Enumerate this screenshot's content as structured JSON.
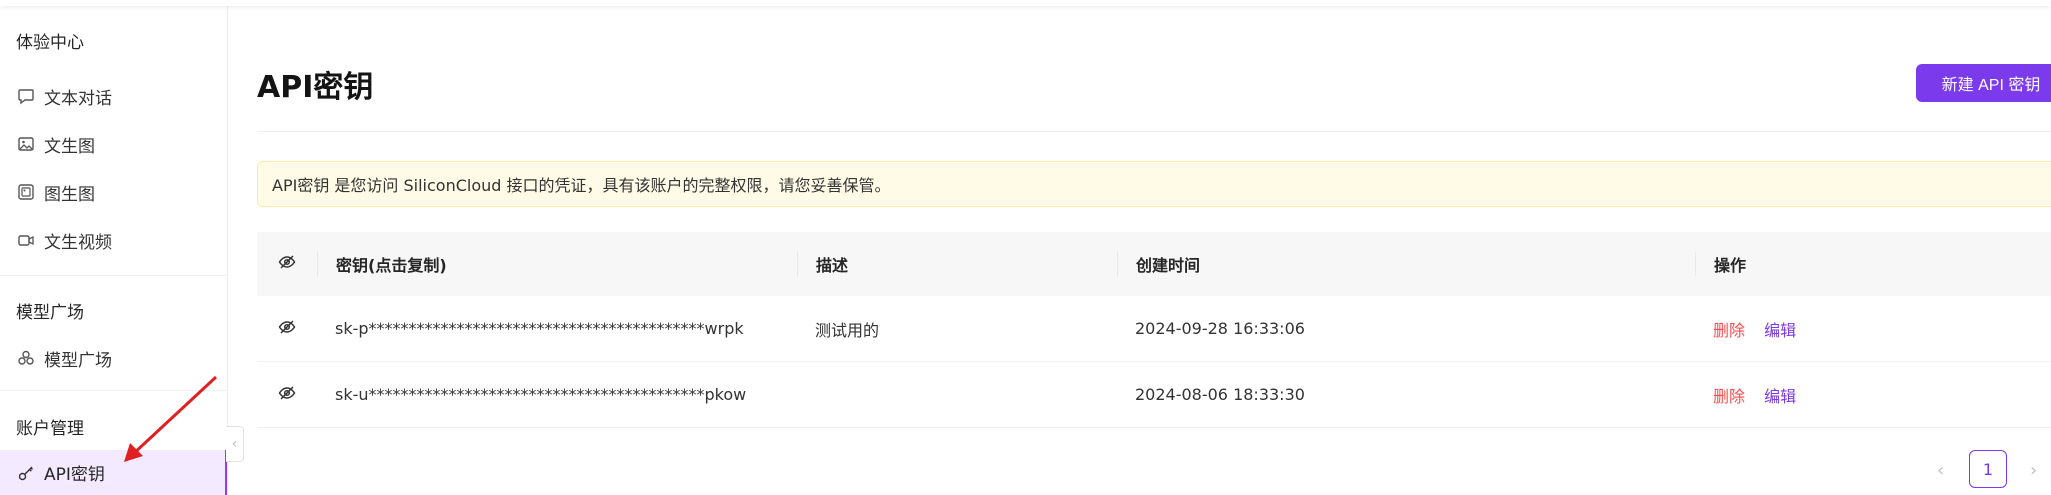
{
  "sidebar": {
    "sections": [
      {
        "title": "体验中心",
        "items": [
          {
            "label": "文本对话",
            "icon": "chat-bubble-icon"
          },
          {
            "label": "文生图",
            "icon": "image-icon"
          },
          {
            "label": "图生图",
            "icon": "images-icon"
          },
          {
            "label": "文生视频",
            "icon": "video-icon"
          }
        ]
      },
      {
        "title": "模型广场",
        "items": [
          {
            "label": "模型广场",
            "icon": "models-icon"
          }
        ]
      },
      {
        "title": "账户管理",
        "items": [
          {
            "label": "API密钥",
            "icon": "key-icon",
            "active": true
          }
        ]
      }
    ]
  },
  "header": {
    "title": "API密钥",
    "new_button": "新建 API 密钥"
  },
  "notice": "API密钥 是您访问 SiliconCloud 接口的凭证，具有该账户的完整权限，请您妥善保管。",
  "table": {
    "columns": [
      "密钥(点击复制)",
      "描述",
      "创建时间",
      "操作"
    ],
    "rows": [
      {
        "key": "sk-p******************************************wrpk",
        "desc": "测试用的",
        "created": "2024-09-28 16:33:06",
        "delete": "删除",
        "edit": "编辑"
      },
      {
        "key": "sk-u******************************************pkow",
        "desc": "",
        "created": "2024-08-06 18:33:30",
        "delete": "删除",
        "edit": "编辑"
      }
    ]
  },
  "pagination": {
    "current": "1",
    "prev": "‹",
    "next": "›"
  },
  "colors": {
    "accent": "#7c3aed",
    "danger": "#ff4d4f",
    "notice_bg": "#fffbe6",
    "annotation_arrow": "#e02020"
  }
}
